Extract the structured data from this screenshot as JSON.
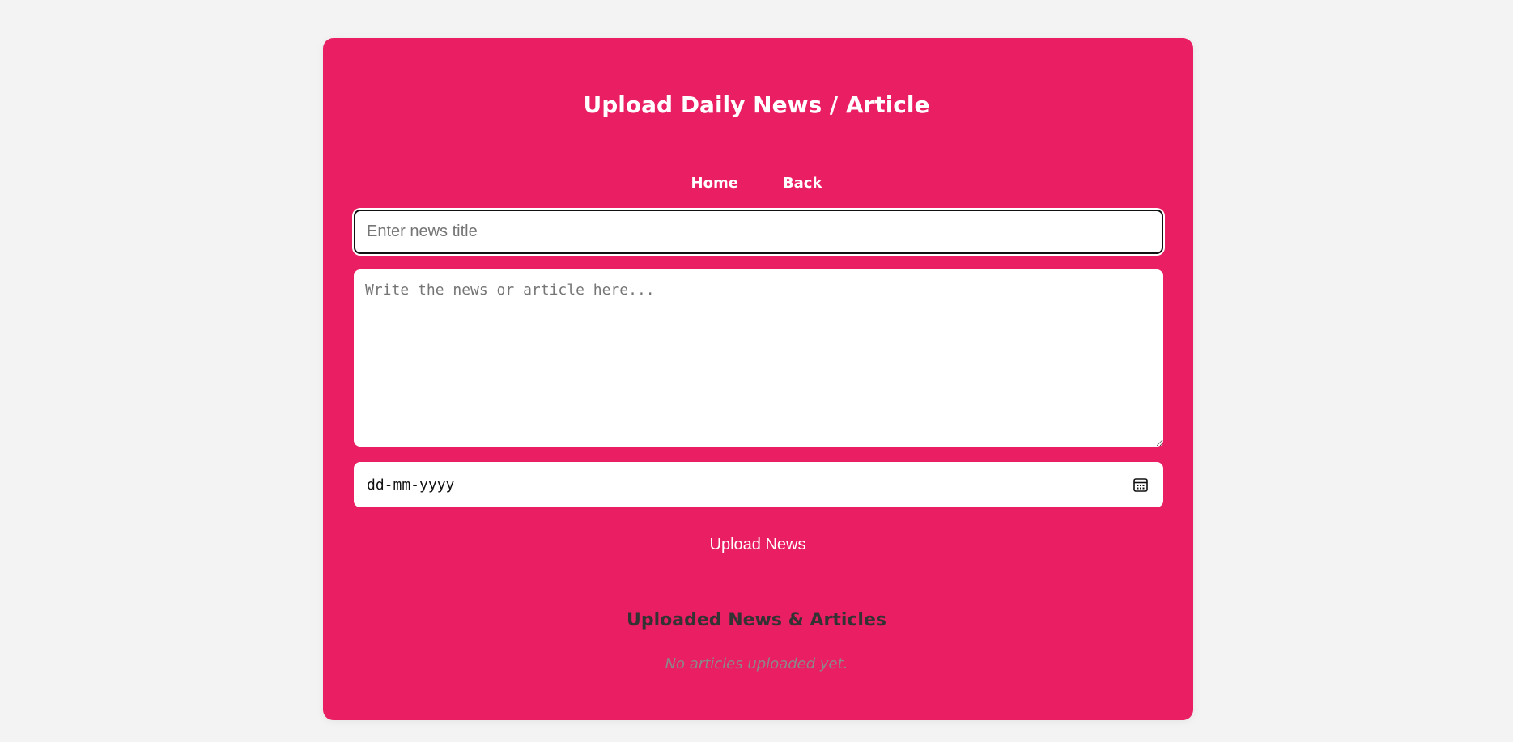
{
  "page": {
    "title": "Upload Daily News / Article"
  },
  "nav": {
    "home_label": "Home",
    "back_label": "Back"
  },
  "form": {
    "title_placeholder": "Enter news title",
    "title_value": "",
    "content_placeholder": "Write the news or article here...",
    "content_value": "",
    "date_display": "dd-mm-yyyy",
    "date_icon": "calendar-icon",
    "submit_label": "Upload News"
  },
  "uploaded": {
    "heading": "Uploaded News & Articles",
    "empty_message": "No articles uploaded yet."
  },
  "colors": {
    "page_background": "#f3f3f3",
    "card_background": "#e91e63",
    "text_on_card": "#ffffff",
    "heading_dark": "#333333",
    "muted_text": "#8a8a8a"
  }
}
